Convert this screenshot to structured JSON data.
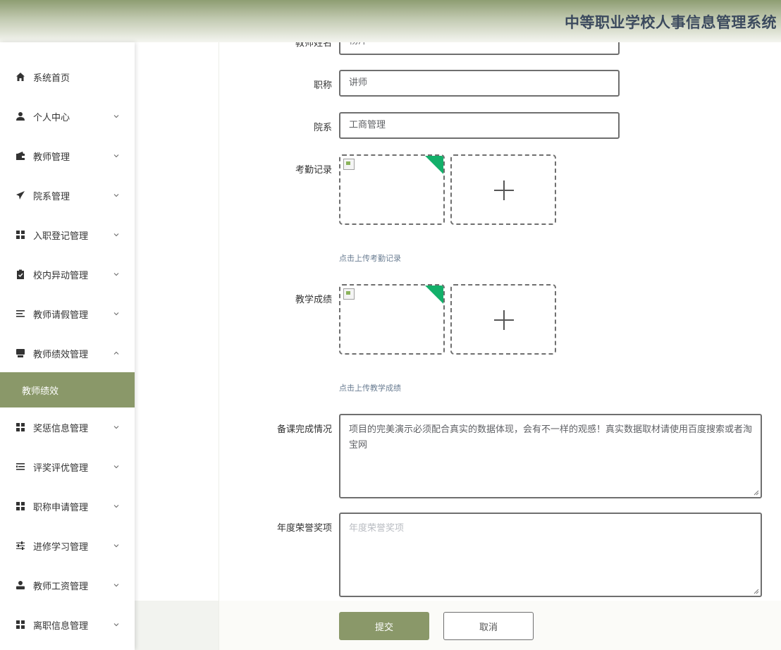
{
  "header": {
    "title": "中等职业学校人事信息管理系统"
  },
  "sidebar": {
    "items": [
      {
        "label": "系统首页",
        "icon": "home-icon",
        "expandable": false
      },
      {
        "label": "个人中心",
        "icon": "user-icon",
        "expandable": true
      },
      {
        "label": "教师管理",
        "icon": "wallet-icon",
        "expandable": true
      },
      {
        "label": "院系管理",
        "icon": "send-icon",
        "expandable": true
      },
      {
        "label": "入职登记管理",
        "icon": "grid-icon",
        "expandable": true
      },
      {
        "label": "校内异动管理",
        "icon": "clipboard-icon",
        "expandable": true
      },
      {
        "label": "教师请假管理",
        "icon": "list-icon",
        "expandable": true
      },
      {
        "label": "教师绩效管理",
        "icon": "shop-icon",
        "expandable": true,
        "expanded": true
      },
      {
        "label": "奖惩信息管理",
        "icon": "grid-icon",
        "expandable": true
      },
      {
        "label": "评奖评优管理",
        "icon": "indent-list-icon",
        "expandable": true
      },
      {
        "label": "职称申请管理",
        "icon": "grid-icon",
        "expandable": true
      },
      {
        "label": "进修学习管理",
        "icon": "sliders-icon",
        "expandable": true
      },
      {
        "label": "教师工资管理",
        "icon": "person-icon",
        "expandable": true
      },
      {
        "label": "离职信息管理",
        "icon": "grid-icon",
        "expandable": true
      }
    ],
    "active_sub": {
      "label": "教师绩效"
    }
  },
  "form": {
    "teacher_name": {
      "label": "教师姓名",
      "value": "杨洋"
    },
    "title": {
      "label": "职称",
      "value": "讲师"
    },
    "department": {
      "label": "院系",
      "value": "工商管理"
    },
    "attendance": {
      "label": "考勤记录",
      "tip": "点击上传考勤记录"
    },
    "teaching": {
      "label": "教学成绩",
      "tip": "点击上传教学成绩"
    },
    "lesson_prep": {
      "label": "备课完成情况",
      "value": "项目的完美演示必须配合真实的数据体现，会有不一样的观感！真实数据取材请使用百度搜索或者淘宝网"
    },
    "honors": {
      "label": "年度荣誉奖项",
      "placeholder": "年度荣誉奖项"
    },
    "submit_label": "提交",
    "cancel_label": "取消"
  },
  "colors": {
    "accent": "#8a9869",
    "header_text": "#3c4a5e",
    "corner_badge": "#13b06a"
  }
}
